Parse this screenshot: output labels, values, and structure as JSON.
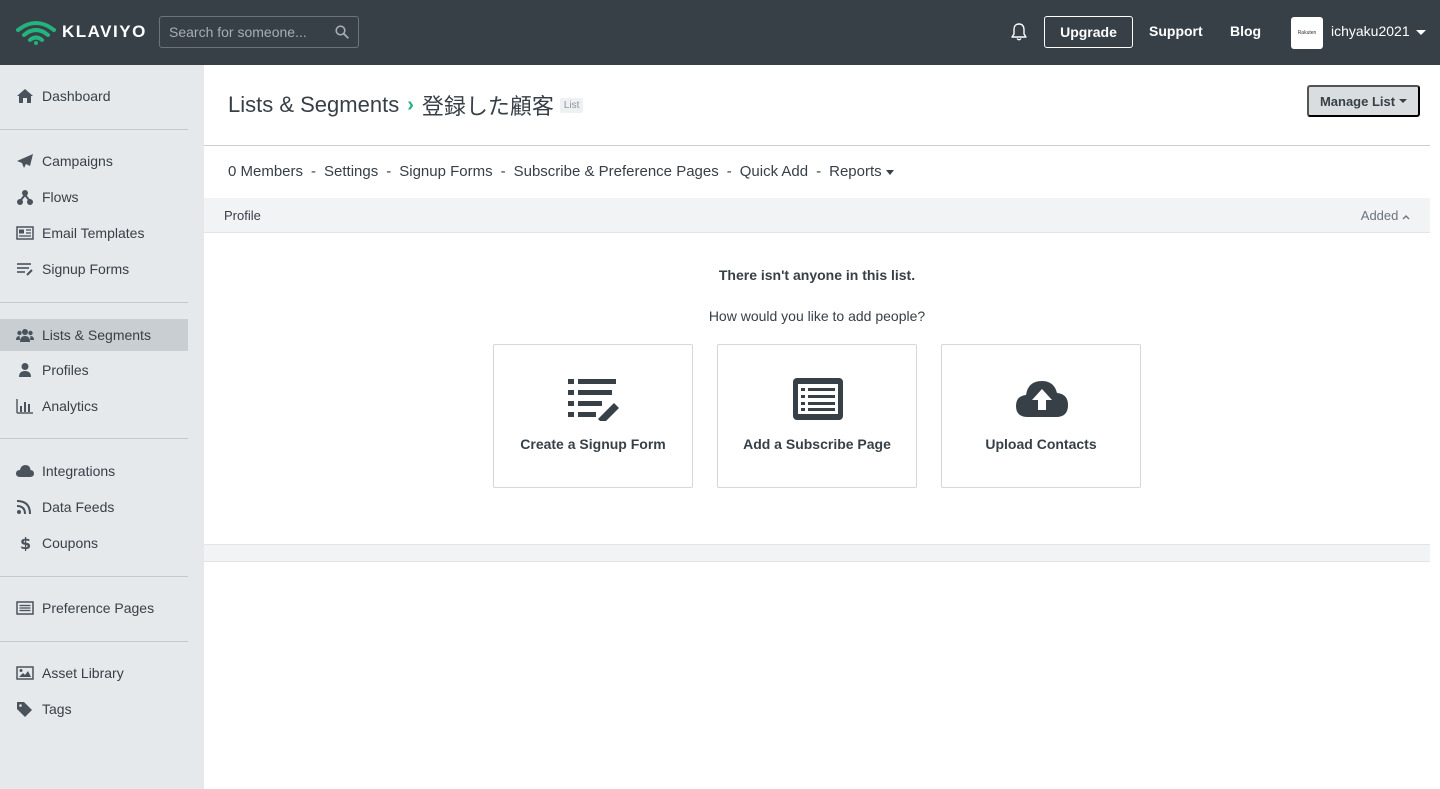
{
  "brand": {
    "name": "KLAVIYO",
    "accent": "#23b37c"
  },
  "header": {
    "search_placeholder": "Search for someone...",
    "upgrade_label": "Upgrade",
    "support_label": "Support",
    "blog_label": "Blog",
    "account_name": "ichyaku2021",
    "avatar_text": "Rakuten"
  },
  "sidebar": {
    "items": [
      {
        "label": "Dashboard",
        "icon": "home-icon"
      },
      {
        "label": "Campaigns",
        "icon": "paper-plane-icon"
      },
      {
        "label": "Flows",
        "icon": "flows-icon"
      },
      {
        "label": "Email Templates",
        "icon": "newspaper-icon"
      },
      {
        "label": "Signup Forms",
        "icon": "list-pencil-icon"
      },
      {
        "label": "Lists & Segments",
        "icon": "users-icon",
        "active": true
      },
      {
        "label": "Profiles",
        "icon": "user-icon"
      },
      {
        "label": "Analytics",
        "icon": "bar-chart-icon"
      },
      {
        "label": "Integrations",
        "icon": "cloud-icon"
      },
      {
        "label": "Data Feeds",
        "icon": "rss-icon"
      },
      {
        "label": "Coupons",
        "icon": "dollar-icon"
      },
      {
        "label": "Preference Pages",
        "icon": "list-alt-icon"
      },
      {
        "label": "Asset Library",
        "icon": "image-icon"
      },
      {
        "label": "Tags",
        "icon": "tag-icon"
      }
    ]
  },
  "main": {
    "breadcrumb_root": "Lists & Segments",
    "list_name": "登録した顧客",
    "list_badge": "List",
    "manage_label": "Manage List",
    "tabs": [
      "0 Members",
      "Settings",
      "Signup Forms",
      "Subscribe & Preference Pages",
      "Quick Add",
      "Reports"
    ],
    "tab_separator": "-",
    "table": {
      "col_profile": "Profile",
      "col_added": "Added"
    },
    "empty_title": "There isn't anyone in this list.",
    "empty_sub": "How would you like to add people?",
    "cards": [
      {
        "label": "Create a Signup Form",
        "icon": "list-pencil-icon"
      },
      {
        "label": "Add a Subscribe Page",
        "icon": "list-alt-icon"
      },
      {
        "label": "Upload Contacts",
        "icon": "cloud-upload-icon"
      }
    ]
  }
}
